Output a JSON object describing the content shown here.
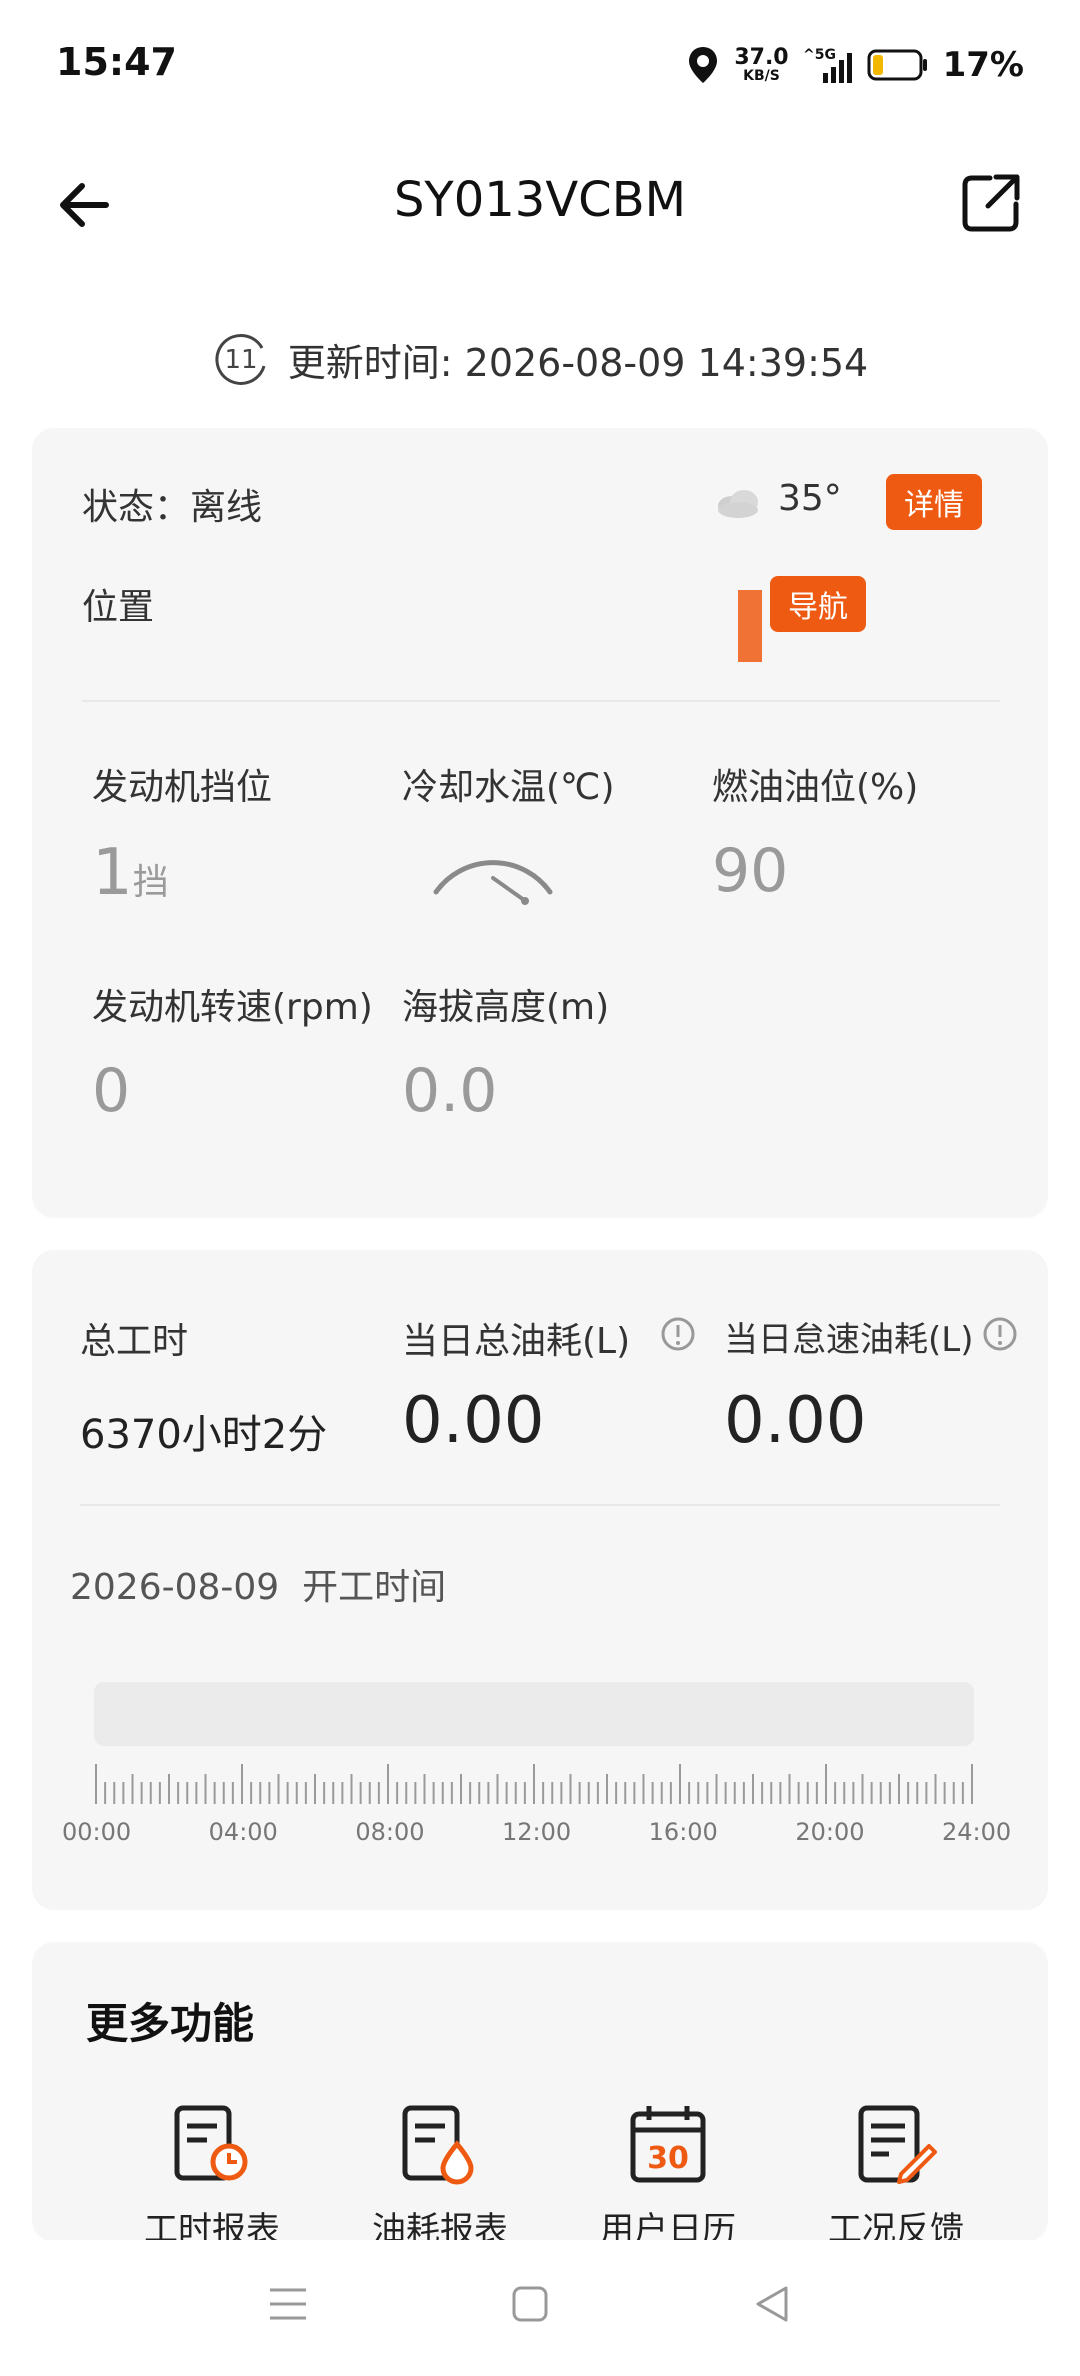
{
  "status_bar": {
    "time": "15:47",
    "net_speed": "37.0",
    "net_unit": "KB/S",
    "network": "5G",
    "battery": "17%",
    "icons": [
      "location-icon",
      "signal-icon",
      "battery-icon"
    ]
  },
  "header": {
    "title": "SY013VCBM",
    "back_icon": "arrow-left-icon",
    "share_icon": "external-link-icon"
  },
  "update": {
    "prefix": "更新时间: ",
    "datetime": "2026-08-09 14:39:54",
    "clock_number": "11"
  },
  "status_card": {
    "status_label": "状态：离线",
    "weather_temp": "35°",
    "details_button": "详情",
    "position_label": "位置",
    "nav_button": "导航",
    "metrics": [
      {
        "label": "发动机挡位",
        "value": "1",
        "unit": "挡"
      },
      {
        "label": "冷却水温(℃)",
        "value": ""
      },
      {
        "label": "燃油油位(%)",
        "value": "90"
      },
      {
        "label": "发动机转速(rpm)",
        "value": "0"
      },
      {
        "label": "海拔高度(m)",
        "value": "0.0"
      }
    ]
  },
  "work_card": {
    "total_hours_label": "总工时",
    "total_hours_value": "6370小时2分",
    "daily_fuel_label": "当日总油耗(L)",
    "daily_fuel_value": "0.00",
    "idle_fuel_label": "当日怠速油耗(L)",
    "idle_fuel_value": "0.00",
    "work_date": "2026-08-09",
    "work_time_label": "开工时间",
    "timeline_labels": [
      "00:00",
      "04:00",
      "08:00",
      "12:00",
      "16:00",
      "20:00",
      "24:00"
    ]
  },
  "more": {
    "title": "更多功能",
    "features": [
      {
        "label": "工时报表",
        "icon": "hours-report-icon"
      },
      {
        "label": "油耗报表",
        "icon": "fuel-report-icon"
      },
      {
        "label": "用户日历",
        "icon": "calendar-icon",
        "badge": "30"
      },
      {
        "label": "工况反馈",
        "icon": "feedback-icon"
      }
    ]
  },
  "accent_color": "#ee5a12"
}
